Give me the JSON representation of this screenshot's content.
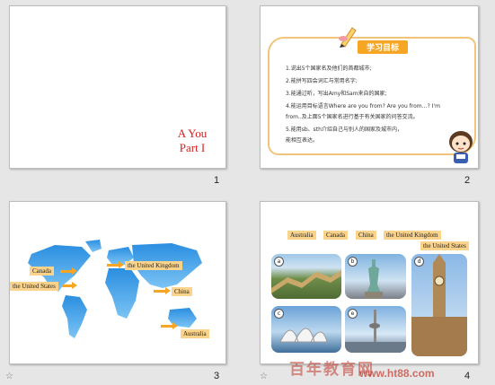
{
  "slides": [
    {
      "number": "1",
      "title_line1": "A You",
      "title_line2": "Part I"
    },
    {
      "number": "2",
      "banner": "学习目标",
      "goals": [
        "1.说出5个国家名及他们的首都城市;",
        "2.能拼写四会词汇与常用名字;",
        "3.能通过听，写出Amy和Sam来自的国家;",
        "4.能运用目标语言Where are you from? Are you from…? I'm",
        "from..及上面5个国家名进行基于有关国家的问答交流。",
        "5.能用sb、sth介绍自己与别人的国家及城市内，",
        "能相互表达。"
      ]
    },
    {
      "number": "3",
      "labels": {
        "uk": "the United Kingdom",
        "canada": "Canada",
        "us": "the United States",
        "china": "China",
        "australia": "Australia"
      }
    },
    {
      "number": "4",
      "labels": [
        "Australia",
        "Canada",
        "China",
        "the United Kingdom",
        "the United States"
      ],
      "photos": [
        {
          "tag": "a",
          "name": "great-wall"
        },
        {
          "tag": "b",
          "name": "statue-of-liberty"
        },
        {
          "tag": "d",
          "name": "big-ben"
        },
        {
          "tag": "c",
          "name": "sydney-opera-house"
        },
        {
          "tag": "e",
          "name": "cn-tower"
        }
      ]
    }
  ],
  "watermark": {
    "text": "百年教育网",
    "url": "www.ht88.com"
  }
}
